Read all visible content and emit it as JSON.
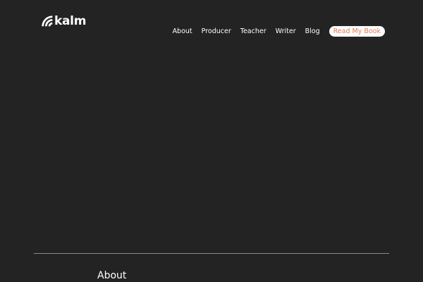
{
  "brand": {
    "name": "kalm",
    "icon": "signal-waves-icon"
  },
  "nav": {
    "items": [
      {
        "label": "About"
      },
      {
        "label": "Producer"
      },
      {
        "label": "Teacher"
      },
      {
        "label": "Writer"
      },
      {
        "label": "Blog"
      }
    ],
    "cta_label": "Read My Book"
  },
  "section": {
    "title": "About"
  },
  "colors": {
    "background": "#232323",
    "text": "#ffffff",
    "accent": "#e07a55",
    "divider": "#8a8a8a"
  }
}
